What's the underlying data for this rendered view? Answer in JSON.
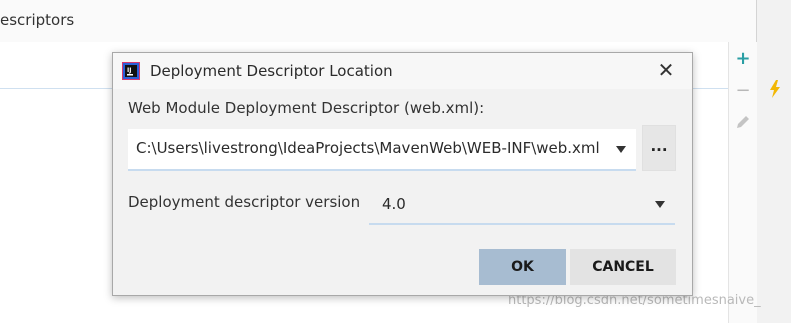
{
  "background": {
    "header_label": "escriptors"
  },
  "side_toolbar": {
    "add_icon": "+",
    "remove_icon": "−"
  },
  "dialog": {
    "title": "Deployment Descriptor Location",
    "close_icon": "✕",
    "descriptor_label": "Web Module Deployment Descriptor (web.xml):",
    "descriptor_path": "C:\\Users\\livestrong\\IdeaProjects\\MavenWeb\\WEB-INF\\web.xml",
    "browse_label": "...",
    "version_label": "Deployment descriptor version",
    "version_value": "4.0",
    "ok_label": "OK",
    "cancel_label": "CANCEL"
  },
  "watermark": "https://blog.csdn.net/sometimesnaive_",
  "colors": {
    "accent": "#2a9ea4",
    "ok_button": "#a7bcd1",
    "combo_underline": "#c7dbef"
  }
}
